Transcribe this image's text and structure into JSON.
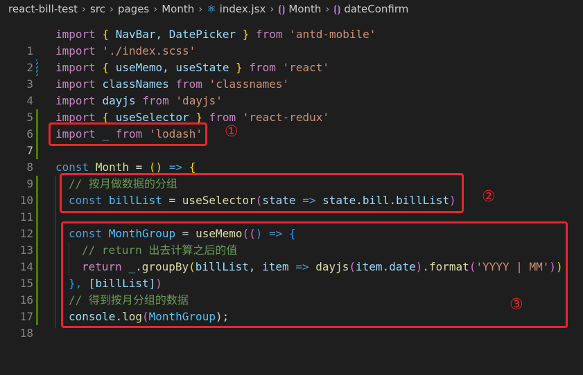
{
  "breadcrumb": {
    "items": [
      "react-bill-test",
      "src",
      "pages",
      "Month",
      "index.jsx",
      "Month",
      "dateConfirm"
    ]
  },
  "lines": [
    {
      "n": "1"
    },
    {
      "n": "2"
    },
    {
      "n": "3"
    },
    {
      "n": "4"
    },
    {
      "n": "5"
    },
    {
      "n": "6"
    },
    {
      "n": "7"
    },
    {
      "n": "8"
    },
    {
      "n": "9"
    },
    {
      "n": "10"
    },
    {
      "n": "11"
    },
    {
      "n": "12"
    },
    {
      "n": "13"
    },
    {
      "n": "14"
    },
    {
      "n": "15"
    },
    {
      "n": "16"
    },
    {
      "n": "17"
    },
    {
      "n": "18"
    }
  ],
  "code": {
    "l1": {
      "a": "import",
      "b": "{",
      "c": " NavBar, DatePicker ",
      "d": "}",
      "e": "from",
      "f": "'antd-mobile'"
    },
    "l2": {
      "a": "import",
      "f": "'./index.scss'"
    },
    "l3": {
      "a": "import",
      "b": "{",
      "c": " useMemo, useState ",
      "d": "}",
      "e": "from",
      "f": "'react'"
    },
    "l4": {
      "a": "import",
      "c": "classNames",
      "e": "from",
      "f": "'classnames'"
    },
    "l5": {
      "a": "import",
      "c": "dayjs",
      "e": "from",
      "f": "'dayjs'"
    },
    "l6": {
      "a": "import",
      "b": "{",
      "c": " useSelector ",
      "d": "}",
      "e": "from",
      "f": "'react-redux'"
    },
    "l7": {
      "a": "import",
      "c": "_",
      "e": "from",
      "f": "'lodash'"
    },
    "l9": {
      "a": "const",
      "c": "Month",
      "eq": "=",
      "p": "()",
      "arrow": "=>",
      "ob": "{"
    },
    "l10": {
      "com": "// 按月做数据的分组"
    },
    "l11": {
      "a": "const",
      "c": "billList",
      "eq": "=",
      "fn": "useSelector",
      "op": "(",
      "v1": "state",
      "arrow": "=>",
      "v2": "state.bill.billList",
      "cp": ")"
    },
    "l13": {
      "a": "const",
      "c": "MonthGroup",
      "eq": "=",
      "fn": "useMemo",
      "op": "((",
      "p": ")",
      "arrow": "=>",
      "ob": "{"
    },
    "l14": {
      "com": "// return 出去计算之后的值"
    },
    "l15": {
      "a": "return",
      "c": "_",
      "fn": "groupBy",
      "op": "(",
      "v1": "billList,",
      "v2": "item",
      "arrow": "=>",
      "fn2": "dayjs",
      "v3": "item.date",
      "fn3": "format",
      "s": "'YYYY | MM'",
      "cp": "))"
    },
    "l16": {
      "a": "},",
      "b": "[billList]",
      "c": ")"
    },
    "l17": {
      "com": "// 得到按月分组的数据"
    },
    "l18": {
      "a": "console",
      "fn": "log",
      "v": "MonthGroup",
      "c": ");"
    }
  },
  "markers": {
    "m1": "①",
    "m2": "②",
    "m3": "③"
  },
  "colors": {
    "annotation": "#e8262a",
    "background": "#1e1e1e"
  }
}
